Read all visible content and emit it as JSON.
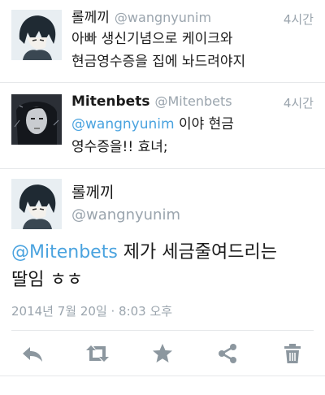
{
  "tweets": [
    {
      "name": "롤께끼",
      "handle": "@wangnyunim",
      "time": "4시간",
      "text_line1": "아빠 생신기념으로 케이크와",
      "text_line2": "현금영수증을 집에 놔드려야지"
    },
    {
      "name": "Mitenbets",
      "handle": "@Mitenbets",
      "time": "4시간",
      "mention": "@wangnyunim",
      "text_line1_rest": " 이야 현금",
      "text_line2": "영수증을!! 효녀;"
    }
  ],
  "detail": {
    "name": "롤께끼",
    "handle": "@wangnyunim",
    "mention": "@Mitenbets",
    "text_line1_rest": " 제가 세금줄여드리는",
    "text_line2": "딸임 ㅎㅎ",
    "timestamp": "2014년 7월 20일 · 8:03 오후"
  },
  "actions": {
    "reply_icon": "reply-icon",
    "retweet_icon": "retweet-icon",
    "favorite_icon": "star-icon",
    "share_icon": "share-icon",
    "delete_icon": "trash-icon"
  },
  "colors": {
    "link": "#4aa3df",
    "muted": "#9aa4ad",
    "action_icon": "#8c979f",
    "divider": "#e6e8ea"
  }
}
